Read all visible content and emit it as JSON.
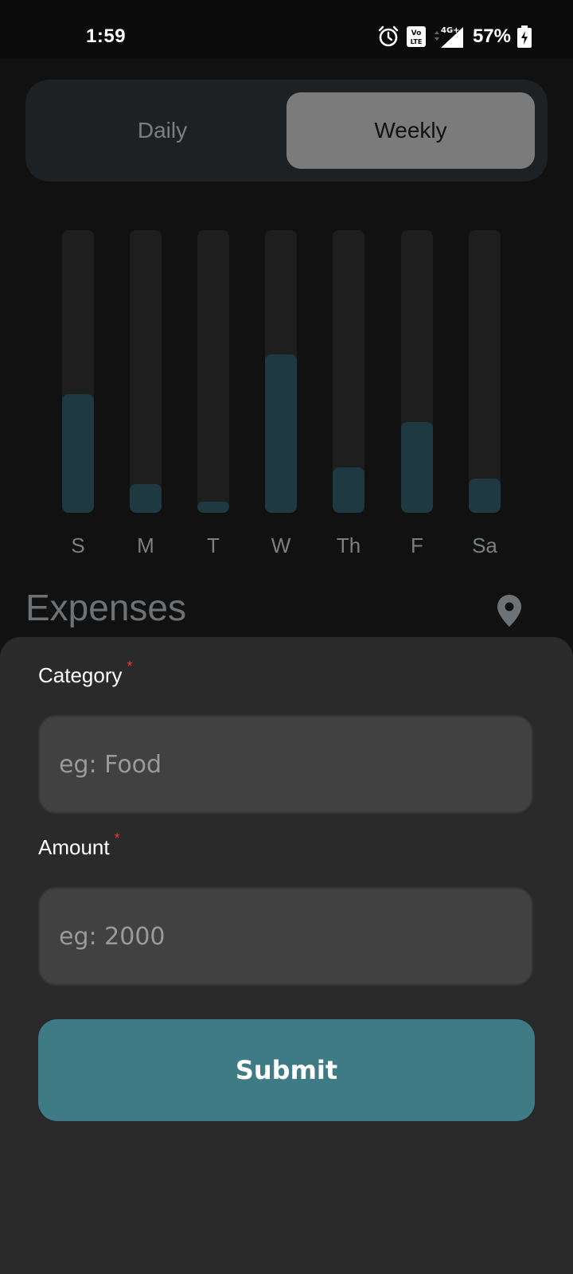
{
  "status_bar": {
    "time": "1:59",
    "network_type": "4G+",
    "volte_label": "VoLTE",
    "battery": "57%",
    "icons": [
      "alarm-icon",
      "volte-icon",
      "signal-icon",
      "battery-charging-icon"
    ]
  },
  "toggle": {
    "options": [
      "Daily",
      "Weekly"
    ],
    "selected": "Weekly"
  },
  "chart_data": {
    "type": "bar",
    "categories": [
      "S",
      "M",
      "T",
      "W",
      "Th",
      "F",
      "Sa"
    ],
    "values": [
      0.42,
      0.1,
      0.04,
      0.56,
      0.16,
      0.32,
      0.12
    ],
    "ylim": [
      0,
      1
    ],
    "bar_color": "#1e3a40",
    "track_color": "#1e1e1e"
  },
  "expenses": {
    "title": "Expenses",
    "location_icon": "map-pin-icon"
  },
  "form": {
    "category_label": "Category",
    "category_placeholder": "eg: Food",
    "amount_label": "Amount",
    "amount_placeholder": "eg: 2000",
    "required_marker": "*",
    "submit_label": "Submit"
  },
  "colors": {
    "accent": "#3e7b85",
    "background": "#111111",
    "sheet": "#2a2a2a",
    "required": "#e53935"
  }
}
